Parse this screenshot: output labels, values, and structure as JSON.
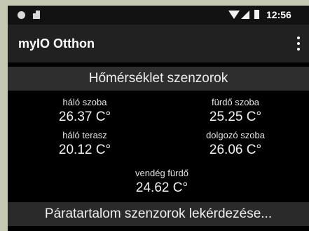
{
  "status_bar": {
    "time": "12:56",
    "icons": [
      "notification-dot-icon",
      "sd-card-icon",
      "wifi-icon",
      "signal-icon",
      "battery-icon"
    ]
  },
  "app_bar": {
    "title": "myIO Otthon",
    "overflow_icon": "more-vert-icon"
  },
  "temperature": {
    "header": "Hőmérséklet szenzorok",
    "sensors": [
      {
        "name": "háló szoba",
        "value": "26.37 C°"
      },
      {
        "name": "fürdő szoba",
        "value": "25.25 C°"
      },
      {
        "name": "háló terasz",
        "value": "20.12 C°"
      },
      {
        "name": "dolgozó szoba",
        "value": "26.06 C°"
      },
      {
        "name": "vendég fürdő",
        "value": "24.62 C°"
      }
    ]
  },
  "humidity": {
    "header": "Páratartalom szenzorok lekérdezése..."
  },
  "colors": {
    "background": "#000000",
    "app_bar": "#212121",
    "section_header": "#2e2e2e",
    "text": "#eeeeee"
  }
}
